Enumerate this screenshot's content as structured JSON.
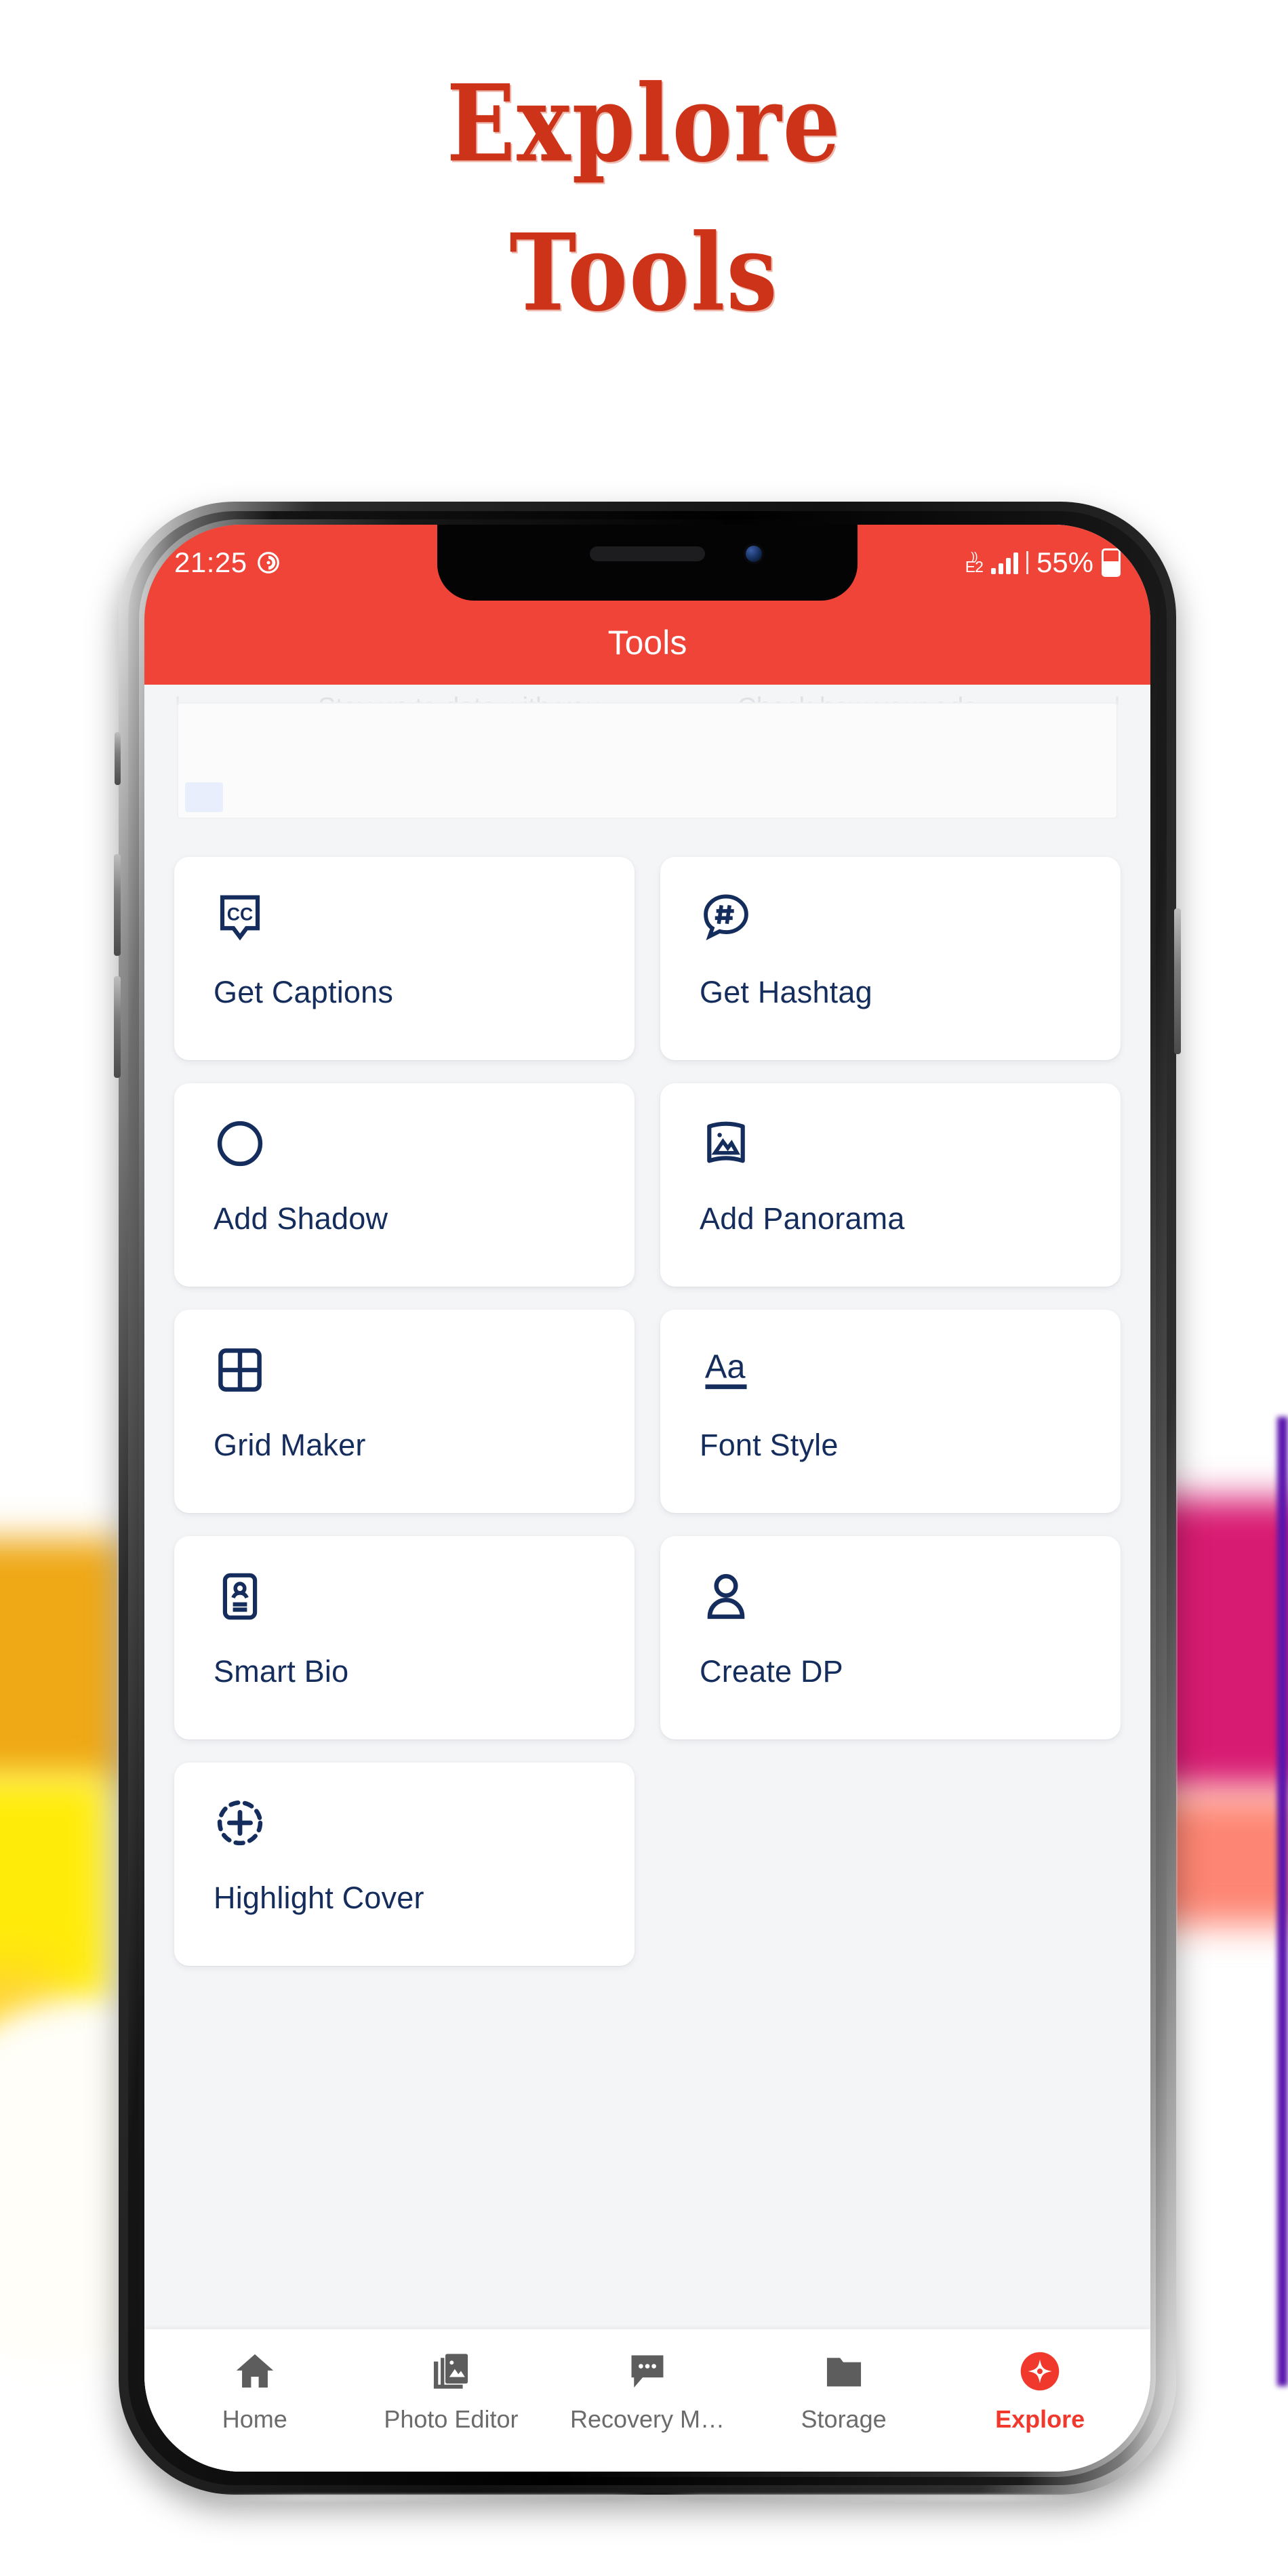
{
  "promo": {
    "line1": "Explore",
    "line2": "Tools",
    "color": "#cc3318"
  },
  "theme": {
    "accent_red": "#ef4437",
    "icon_navy": "#152d5c",
    "page_bg": "#f4f5f7",
    "card_bg": "#ffffff",
    "nav_inactive": "#6b6b6b",
    "nav_active": "#f0392c"
  },
  "status_bar": {
    "time": "21:25",
    "alarm_icon": "alarm-icon",
    "network_label_top": "))",
    "network_label_bottom": "E2",
    "signal_icon": "signal-bars-icon",
    "battery_percent": "55%",
    "battery_level": 55,
    "battery_icon": "battery-icon"
  },
  "app_bar": {
    "title": "Tools"
  },
  "ad_placeholder": {
    "left_text": "Stay up to date with you",
    "right_text": "Check how your ads",
    "pipe": "|"
  },
  "tools": [
    {
      "label": "Get Captions",
      "icon": "closed-caption-icon"
    },
    {
      "label": "Get Hashtag",
      "icon": "hashtag-bubble-icon"
    },
    {
      "label": "Add Shadow",
      "icon": "shadow-circle-icon"
    },
    {
      "label": "Add Panorama",
      "icon": "panorama-icon"
    },
    {
      "label": "Grid Maker",
      "icon": "grid-2x2-icon"
    },
    {
      "label": "Font Style",
      "icon": "font-aa-icon"
    },
    {
      "label": "Smart Bio",
      "icon": "id-card-icon"
    },
    {
      "label": "Create DP",
      "icon": "person-icon"
    },
    {
      "label": "Highlight Cover",
      "icon": "dashed-circle-plus-icon"
    }
  ],
  "bottom_nav": {
    "items": [
      {
        "label": "Home",
        "icon": "home-icon",
        "active": false
      },
      {
        "label": "Photo Editor",
        "icon": "photo-book-icon",
        "active": false
      },
      {
        "label": "Recovery M…",
        "icon": "chat-dots-icon",
        "active": false
      },
      {
        "label": "Storage",
        "icon": "folder-icon",
        "active": false
      },
      {
        "label": "Explore",
        "icon": "compass-star-icon",
        "active": true
      }
    ]
  }
}
